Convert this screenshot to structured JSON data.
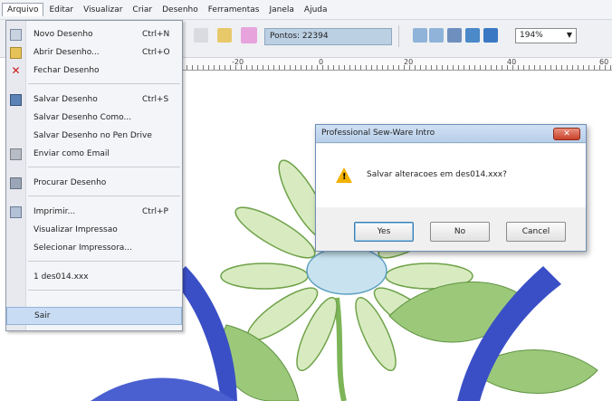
{
  "menubar": {
    "items": [
      "Arquivo",
      "Editar",
      "Visualizar",
      "Criar",
      "Desenho",
      "Ferramentas",
      "Janela",
      "Ajuda"
    ]
  },
  "toolbar": {
    "points_text": "Pontos: 22394",
    "zoom_value": "194%"
  },
  "ruler": {
    "labels": [
      "-20",
      "0",
      "20",
      "40",
      "60"
    ]
  },
  "file_menu": {
    "items": [
      {
        "label": "Novo Desenho",
        "shortcut": "Ctrl+N",
        "icon": "new-document-icon"
      },
      {
        "label": "Abrir Desenho...",
        "shortcut": "Ctrl+O",
        "icon": "open-folder-icon"
      },
      {
        "label": "Fechar Desenho",
        "shortcut": "",
        "icon": "close-x-icon"
      },
      {
        "label": "Salvar Desenho",
        "shortcut": "Ctrl+S",
        "icon": "save-disk-icon"
      },
      {
        "label": "Salvar Desenho Como...",
        "shortcut": "",
        "icon": ""
      },
      {
        "label": "Salvar Desenho no Pen Drive",
        "shortcut": "",
        "icon": ""
      },
      {
        "label": "Enviar como Email",
        "shortcut": "",
        "icon": "email-icon"
      },
      {
        "label": "Procurar Desenho",
        "shortcut": "",
        "icon": "browse-icon"
      },
      {
        "label": "Imprimir...",
        "shortcut": "Ctrl+P",
        "icon": "print-icon"
      },
      {
        "label": "Visualizar Impressao",
        "shortcut": "",
        "icon": ""
      },
      {
        "label": "Selecionar Impressora...",
        "shortcut": "",
        "icon": ""
      },
      {
        "label": "1 des014.xxx",
        "shortcut": "",
        "icon": ""
      },
      {
        "label": "Sair",
        "shortcut": "",
        "icon": ""
      }
    ]
  },
  "dialog": {
    "title": "Professional Sew-Ware Intro",
    "message": "Salvar alteracoes em des014.xxx?",
    "buttons": [
      "Yes",
      "No",
      "Cancel"
    ]
  },
  "colors": {
    "petal_fill": "#d8ebc0",
    "petal_stroke": "#6fa24a",
    "blue_stitch": "#3a4fc6",
    "leaf_green": "#9cc87a",
    "swatch_pink": "#e7a4dc"
  }
}
